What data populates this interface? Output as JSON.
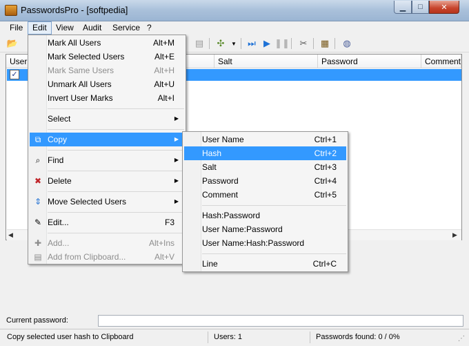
{
  "window": {
    "title": "PasswordsPro - [softpedia]",
    "watermark": "SOFTPEDIA"
  },
  "menubar": [
    "File",
    "Edit",
    "View",
    "Audit",
    "Service",
    "?"
  ],
  "columns": [
    "User",
    "Salt",
    "Password",
    "Comment"
  ],
  "edit_menu": [
    {
      "label": "Mark All Users",
      "shortcut": "Alt+M"
    },
    {
      "label": "Mark Selected Users",
      "shortcut": "Alt+E"
    },
    {
      "label": "Mark Same Users",
      "shortcut": "Alt+H",
      "disabled": true
    },
    {
      "label": "Unmark All Users",
      "shortcut": "Alt+U"
    },
    {
      "label": "Invert User Marks",
      "shortcut": "Alt+I"
    },
    {
      "label": "Select",
      "submenu": true
    },
    {
      "label": "Copy",
      "submenu": true,
      "highlighted": true
    },
    {
      "label": "Find",
      "submenu": true
    },
    {
      "label": "Delete",
      "submenu": true
    },
    {
      "label": "Move Selected Users",
      "submenu": true
    },
    {
      "label": "Edit...",
      "shortcut": "F3"
    },
    {
      "label": "Add...",
      "shortcut": "Alt+Ins",
      "disabled": true
    },
    {
      "label": "Add from Clipboard...",
      "shortcut": "Alt+V",
      "disabled": true
    }
  ],
  "copy_menu": [
    {
      "label": "User Name",
      "shortcut": "Ctrl+1"
    },
    {
      "label": "Hash",
      "shortcut": "Ctrl+2",
      "highlighted": true
    },
    {
      "label": "Salt",
      "shortcut": "Ctrl+3"
    },
    {
      "label": "Password",
      "shortcut": "Ctrl+4"
    },
    {
      "label": "Comment",
      "shortcut": "Ctrl+5"
    },
    {
      "label": "Hash:Password"
    },
    {
      "label": "User Name:Password"
    },
    {
      "label": "User Name:Hash:Password"
    },
    {
      "label": "Line",
      "shortcut": "Ctrl+C"
    }
  ],
  "current_password_label": "Current password:",
  "status": {
    "message": "Copy selected user hash to Clipboard",
    "users": "Users: 1",
    "found": "Passwords found: 0 / 0%"
  },
  "colors": {
    "highlight": "#3399ff"
  }
}
